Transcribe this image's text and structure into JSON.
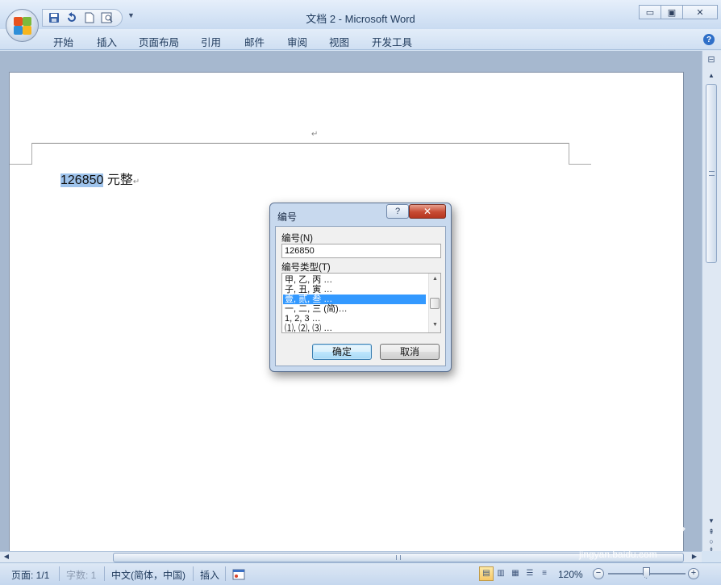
{
  "window": {
    "title": "文档 2 - Microsoft Word",
    "minimize_icon": "minimize-icon",
    "maximize_icon": "restore-icon",
    "close_icon": "close-icon"
  },
  "quick_access": {
    "save_icon": "save-icon",
    "undo_icon": "undo-icon",
    "new_icon": "new-document-icon",
    "print_preview_icon": "print-preview-icon",
    "customize_icon": "dropdown-arrow-icon"
  },
  "ribbon": {
    "tabs": [
      "开始",
      "插入",
      "页面布局",
      "引用",
      "邮件",
      "审阅",
      "视图",
      "开发工具"
    ],
    "help_label": "?"
  },
  "document": {
    "header_mark": "↵",
    "selected_text": "126850",
    "rest_text": " 元整",
    "paragraph_mark": "↵"
  },
  "dialog": {
    "title": "编号",
    "help_label": "?",
    "close_label": "✕",
    "number_label": "编号(N)",
    "number_value": "126850",
    "type_label": "编号类型(T)",
    "types": [
      "甲, 乙, 丙 …",
      "子, 丑, 寅 …",
      "壹, 贰, 叁 …",
      "一, 二, 三 (简)…",
      "1, 2, 3 …",
      "⑴, ⑵, ⑶ …"
    ],
    "selected_index": 2,
    "ok_label": "确定",
    "cancel_label": "取消"
  },
  "status": {
    "page": "页面: 1/1",
    "words": "字数: 1",
    "language": "中文(简体，中国)",
    "mode": "插入",
    "zoom": "120%",
    "zoom_minus": "−",
    "zoom_plus": "+"
  },
  "watermark": {
    "brand": "Baidu经验",
    "url": "jingyan.baidu.com"
  },
  "colors": {
    "selection": "#9ec3ec",
    "list_selection": "#3399ff",
    "close_button": "#c74a33",
    "frame": "#d6e4f3"
  }
}
